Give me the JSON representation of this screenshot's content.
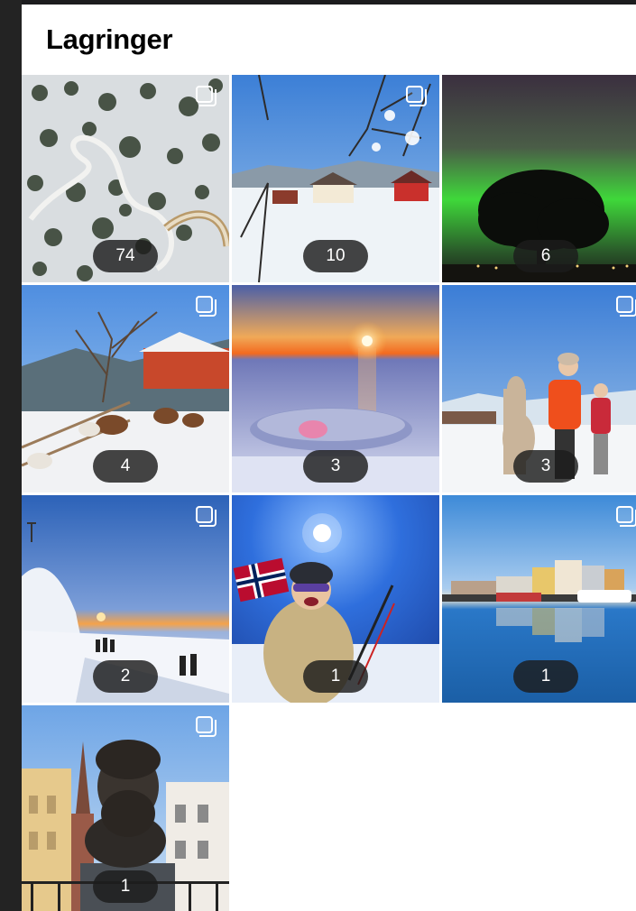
{
  "header": {
    "title": "Lagringer"
  },
  "collections": [
    {
      "count": "74",
      "multi": true
    },
    {
      "count": "10",
      "multi": true
    },
    {
      "count": "6",
      "multi": false
    },
    {
      "count": "4",
      "multi": true
    },
    {
      "count": "3",
      "multi": false
    },
    {
      "count": "3",
      "multi": true
    },
    {
      "count": "2",
      "multi": true
    },
    {
      "count": "1",
      "multi": false
    },
    {
      "count": "1",
      "multi": true
    },
    {
      "count": "1",
      "multi": true
    }
  ],
  "icons": {
    "multi_post": "carousel-icon"
  },
  "colors": {
    "badge_bg": "#1c1c1c",
    "panel_bg": "#ffffff",
    "title": "#000000"
  }
}
